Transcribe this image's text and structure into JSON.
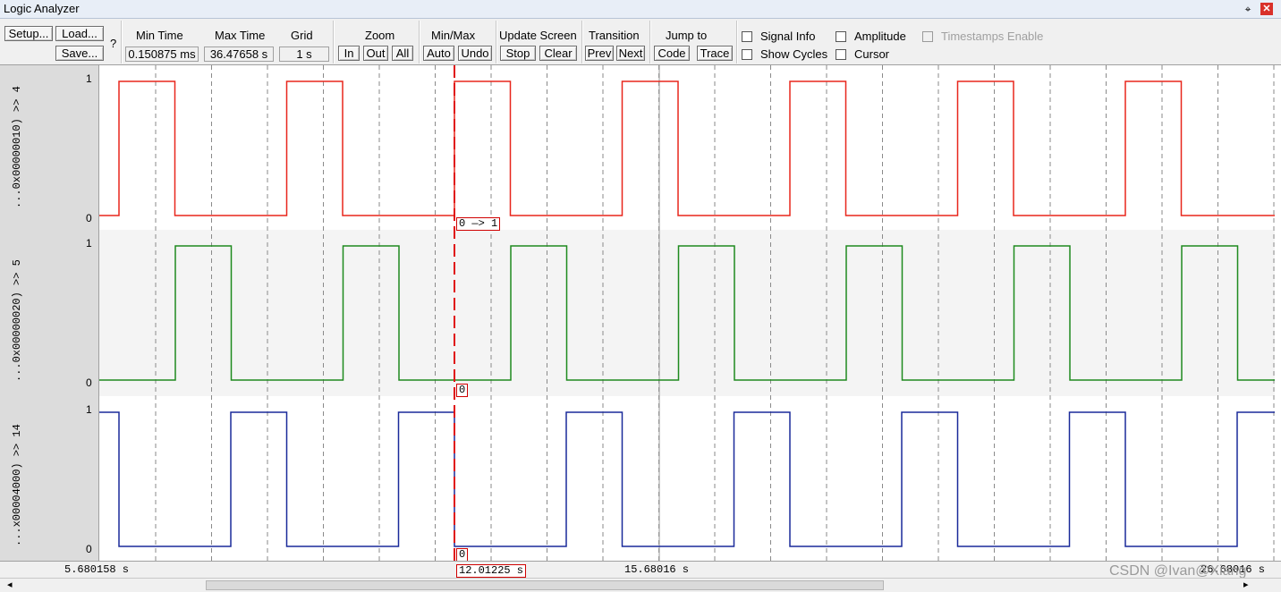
{
  "window": {
    "title": "Logic Analyzer",
    "pin_icon": "pin-icon",
    "close_icon": "close-icon"
  },
  "toolbar": {
    "setup": "Setup...",
    "load": "Load...",
    "save": "Save...",
    "help": "?",
    "min_time_label": "Min Time",
    "min_time_value": "0.150875 ms",
    "max_time_label": "Max Time",
    "max_time_value": "36.47658 s",
    "grid_label": "Grid",
    "grid_value": "1 s",
    "zoom_label": "Zoom",
    "zoom_in": "In",
    "zoom_out": "Out",
    "zoom_all": "All",
    "minmax_label": "Min/Max",
    "auto": "Auto",
    "undo": "Undo",
    "update_label": "Update Screen",
    "stop": "Stop",
    "clear": "Clear",
    "transition_label": "Transition",
    "prev": "Prev",
    "next": "Next",
    "jump_label": "Jump to",
    "code": "Code",
    "trace": "Trace",
    "signal_info": "Signal Info",
    "show_cycles": "Show Cycles",
    "amplitude": "Amplitude",
    "cursor": "Cursor",
    "timestamps": "Timestamps Enable"
  },
  "signals": [
    {
      "name": "...0x00000010) >> 4",
      "color": "#e8261c",
      "y_high": "1",
      "y_low": "0",
      "start": 0,
      "period": 1.0,
      "offset": 0.33,
      "cursor_text": "0 —> 1"
    },
    {
      "name": "...0x00000020) >> 5",
      "color": "#1e8a1e",
      "y_high": "1",
      "y_low": "0",
      "start": 0,
      "period": 1.0,
      "offset": 0.67,
      "cursor_text": "0"
    },
    {
      "name": "...x00004000) >> 14",
      "color": "#1a2a9a",
      "y_high": "1",
      "y_low": "0",
      "start": 1,
      "period": 1.0,
      "offset": 0.0,
      "cursor_text": "0"
    }
  ],
  "timeline": {
    "start": "5.680158 s",
    "cursor": "12.01225 s",
    "middle": "15.68016 s",
    "end": "26.68016 s"
  },
  "watermark": "CSDN @Ivan@Xiang",
  "scrollbar": {
    "left_arrow": "◂",
    "right_arrow": "▸"
  }
}
